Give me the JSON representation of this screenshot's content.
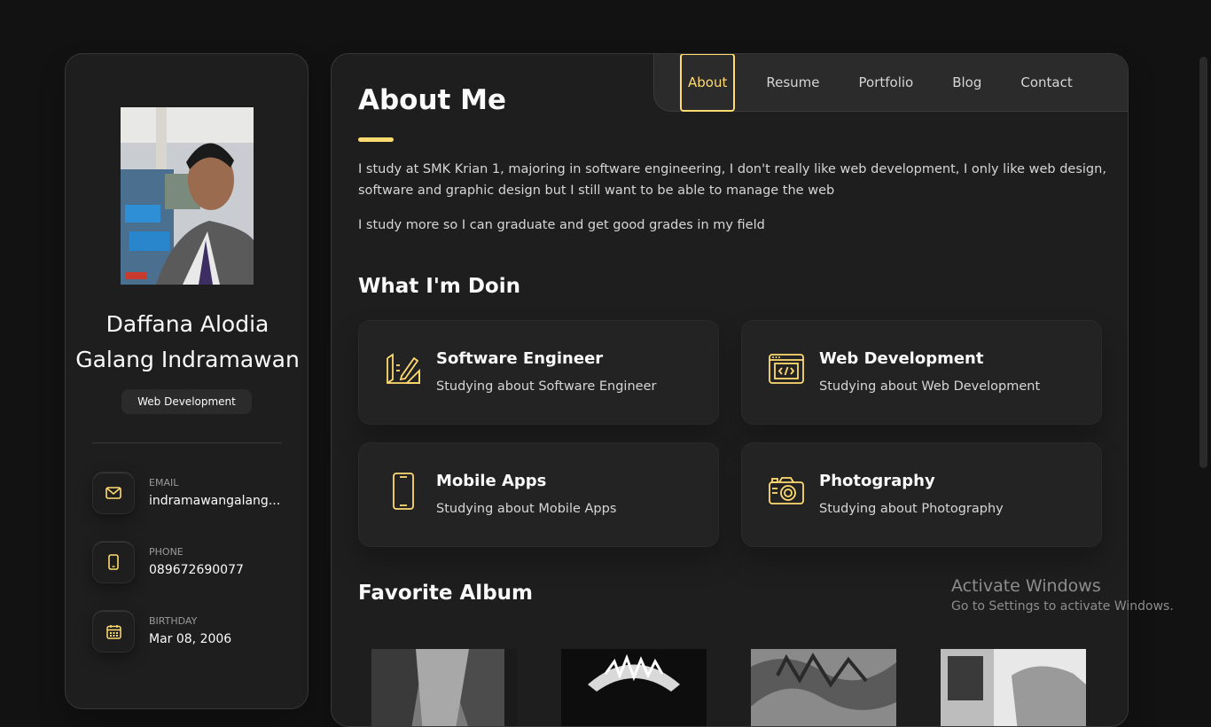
{
  "sidebar": {
    "name": "Daffana Alodia Galang Indramawan",
    "title": "Web Development",
    "contacts": [
      {
        "label": "EMAIL",
        "value": "indramawangalang...",
        "icon": "mail-icon"
      },
      {
        "label": "PHONE",
        "value": "089672690077",
        "icon": "phone-icon"
      },
      {
        "label": "BIRTHDAY",
        "value": "Mar 08, 2006",
        "icon": "calendar-icon"
      }
    ]
  },
  "nav": {
    "items": [
      "About",
      "Resume",
      "Portfolio",
      "Blog",
      "Contact"
    ],
    "active": "About"
  },
  "about": {
    "title": "About Me",
    "paragraphs": [
      "I study at SMK Krian 1, majoring in software engineering, I don't really like web development, I only like web design, software and graphic design but I still want to be able to manage the web",
      "I study more so I can graduate and get good grades in my field"
    ]
  },
  "services": {
    "title": "What I'm Doin",
    "items": [
      {
        "title": "Software Engineer",
        "text": "Studying about Software Engineer",
        "icon": "design-tools-icon"
      },
      {
        "title": "Web Development",
        "text": "Studying about Web Development",
        "icon": "code-window-icon"
      },
      {
        "title": "Mobile Apps",
        "text": "Studying about Mobile Apps",
        "icon": "smartphone-icon"
      },
      {
        "title": "Photography",
        "text": "Studying about Photography",
        "icon": "camera-icon"
      }
    ]
  },
  "albums": {
    "title": "Favorite Album"
  },
  "watermark": {
    "line1": "Activate Windows",
    "line2": "Go to Settings to activate Windows."
  },
  "colors": {
    "accent": "#ffdb70",
    "background": "#121212",
    "card": "#1e1e1f"
  }
}
